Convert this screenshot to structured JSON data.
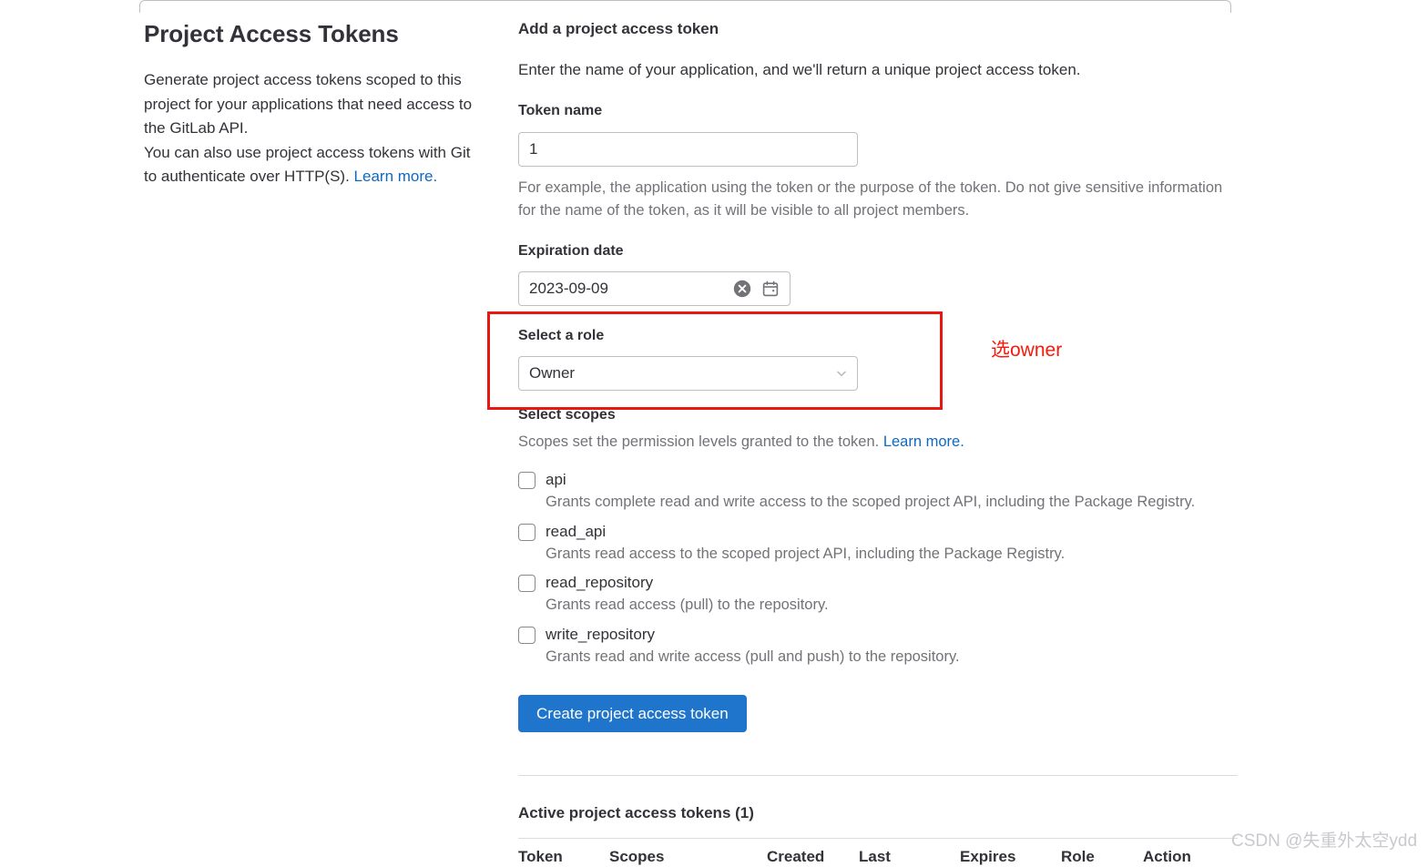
{
  "left": {
    "title": "Project Access Tokens",
    "desc_line1": "Generate project access tokens scoped to this project for your applications that need access to the GitLab API.",
    "desc_line2_pre": "You can also use project access tokens with Git to authenticate over HTTP(S). ",
    "desc_link": "Learn more."
  },
  "form": {
    "heading": "Add a project access token",
    "subheading": "Enter the name of your application, and we'll return a unique project access token.",
    "token_name_label": "Token name",
    "token_name_value": "1",
    "token_name_placeholder": "",
    "token_name_help": "For example, the application using the token or the purpose of the token. Do not give sensitive information for the name of the token, as it will be visible to all project members.",
    "expiration_label": "Expiration date",
    "expiration_value": "2023-09-09",
    "expiration_placeholder": "YYYY-MM-DD",
    "role_label": "Select a role",
    "role_value": "Owner",
    "submit_label": "Create project access token"
  },
  "scopes": {
    "heading": "Select scopes",
    "intro_pre": "Scopes set the permission levels granted to the token. ",
    "intro_link": "Learn more.",
    "items": [
      {
        "name": "api",
        "desc": "Grants complete read and write access to the scoped project API, including the Package Registry.",
        "checked": false
      },
      {
        "name": "read_api",
        "desc": "Grants read access to the scoped project API, including the Package Registry.",
        "checked": false
      },
      {
        "name": "read_repository",
        "desc": "Grants read access (pull) to the repository.",
        "checked": false
      },
      {
        "name": "write_repository",
        "desc": "Grants read and write access (pull and push) to the repository.",
        "checked": false
      }
    ]
  },
  "active_tokens": {
    "title": "Active project access tokens (1)",
    "columns": [
      "Token",
      "Scopes",
      "Created",
      "Last",
      "Expires",
      "Role",
      "Action"
    ]
  },
  "annotation": {
    "text": "选owner",
    "color": "#f61a0c"
  },
  "watermark": {
    "text": "CSDN @失重外太空ydd"
  },
  "colors": {
    "primary": "#1f75cb",
    "link": "#1068bf",
    "text": "#333238",
    "muted": "#737278",
    "border": "#bfbfc3",
    "divider": "#dcdcde",
    "annotation_red": "#e8170f"
  }
}
